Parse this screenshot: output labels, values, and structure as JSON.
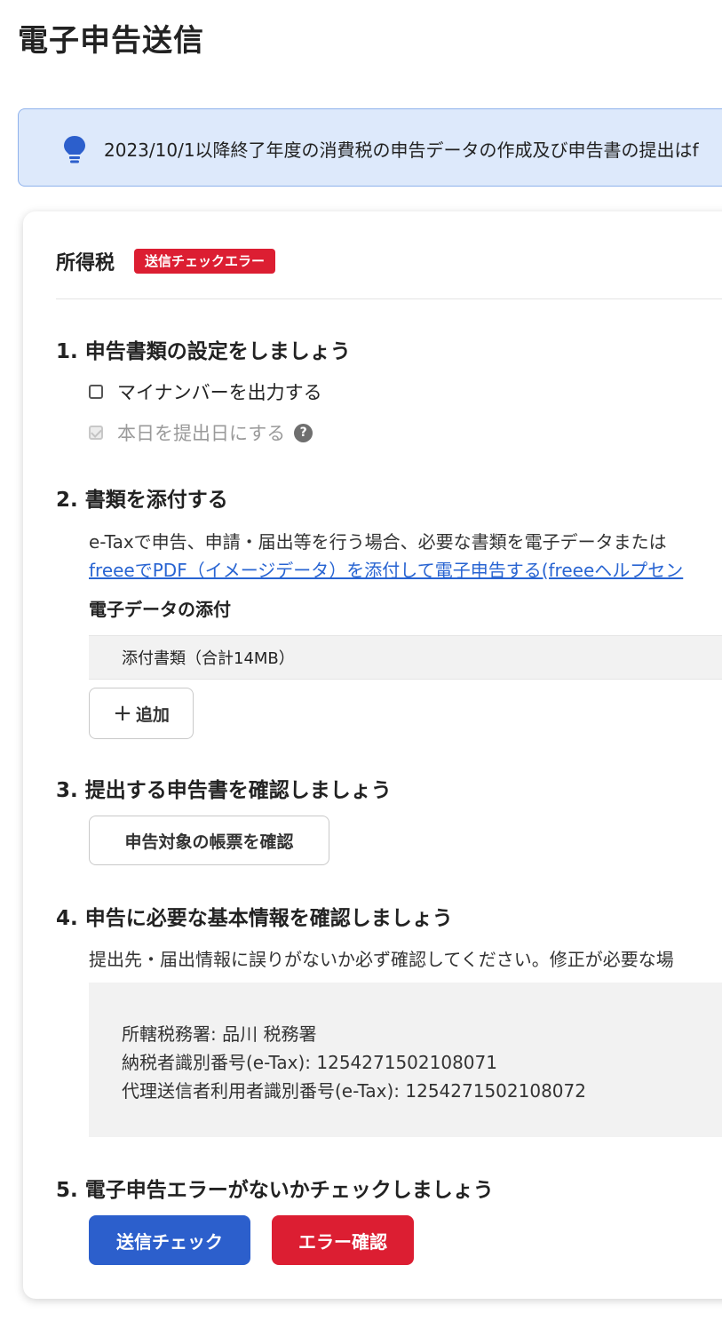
{
  "page": {
    "title": "電子申告送信"
  },
  "banner": {
    "text": "2023/10/1以降終了年度の消費税の申告データの作成及び申告書の提出はf",
    "icon": "lightbulb-icon",
    "color": "#dde9fb"
  },
  "card": {
    "title": "所得税",
    "badge": "送信チェックエラー",
    "badge_color": "#dc1e32"
  },
  "step1": {
    "heading": "1. 申告書類の設定をしましょう",
    "checkbox_mynumber": {
      "label": "マイナンバーを出力する",
      "checked": false
    },
    "checkbox_today": {
      "label": "本日を提出日にする",
      "checked": true,
      "disabled": true
    },
    "help_icon": "?"
  },
  "step2": {
    "heading": "2. 書類を添付する",
    "description": "e-Taxで申告、申請・届出等を行う場合、必要な書類を電子データまたは",
    "help_link": "freeeでPDF（イメージデータ）を添付して電子申告する(freeeヘルプセン",
    "subheading": "電子データの添付",
    "attachments_label": "添付書類（合計14MB）",
    "add_button": {
      "icon": "+",
      "label": "追加"
    }
  },
  "step3": {
    "heading": "3. 提出する申告書を確認しましょう",
    "button": "申告対象の帳票を確認"
  },
  "step4": {
    "heading": "4. 申告に必要な基本情報を確認しましょう",
    "description": "提出先・届出情報に誤りがないか必ず確認してください。修正が必要な場",
    "info": {
      "tax_office": "所轄税務署: 品川 税務署",
      "taxpayer_id": "納税者識別番号(e-Tax): 1254271502108071",
      "agent_id": "代理送信者利用者識別番号(e-Tax): 1254271502108072"
    }
  },
  "step5": {
    "heading": "5. 電子申告エラーがないかチェックしましょう",
    "check_button": "送信チェック",
    "error_button": "エラー確認",
    "primary_color": "#2c5fcc",
    "danger_color": "#dc1e32"
  }
}
